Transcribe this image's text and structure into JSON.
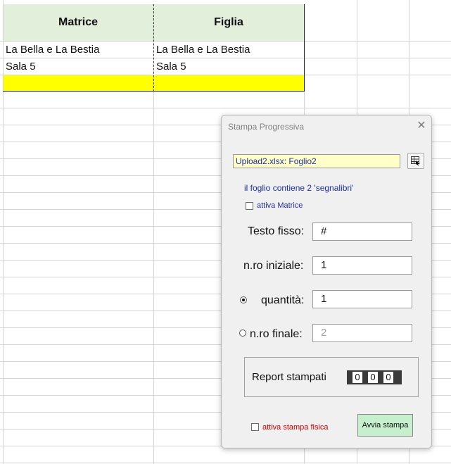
{
  "sheet": {
    "headers": [
      "Matrice",
      "Figlia"
    ],
    "rows": [
      [
        "La Bella e La Bestia",
        "La Bella e La Bestia"
      ],
      [
        "Sala 5",
        "Sala 5"
      ]
    ]
  },
  "dialog": {
    "title": "Stampa Progressiva",
    "close_label": "✕",
    "file_value": "Upload2.xlsx: Foglio2",
    "info_text": "il foglio contiene 2 'segnalibri'",
    "attiva_matrice_label": "attiva Matrice",
    "attiva_matrice_checked": false,
    "testo_fisso_label": "Testo fisso:",
    "testo_fisso_value": "#",
    "nro_iniziale_label": "n.ro iniziale:",
    "nro_iniziale_value": "1",
    "quantita_label": "quantità:",
    "quantita_value": "1",
    "quantita_selected": true,
    "nro_finale_label": "n.ro finale:",
    "nro_finale_value": "2",
    "report_label": "Report stampati",
    "report_digits": [
      "0",
      "0",
      "0"
    ],
    "stampa_fisica_label": "attiva stampa fisica",
    "stampa_fisica_checked": false,
    "avvia_label": "Avvia stampa",
    "colors": {
      "info_blue": "#1f2fa6",
      "warn_red": "#cc0000",
      "header_green": "#e2efda",
      "highlight_yellow": "#ffff00",
      "button_green": "#c6efce"
    }
  }
}
